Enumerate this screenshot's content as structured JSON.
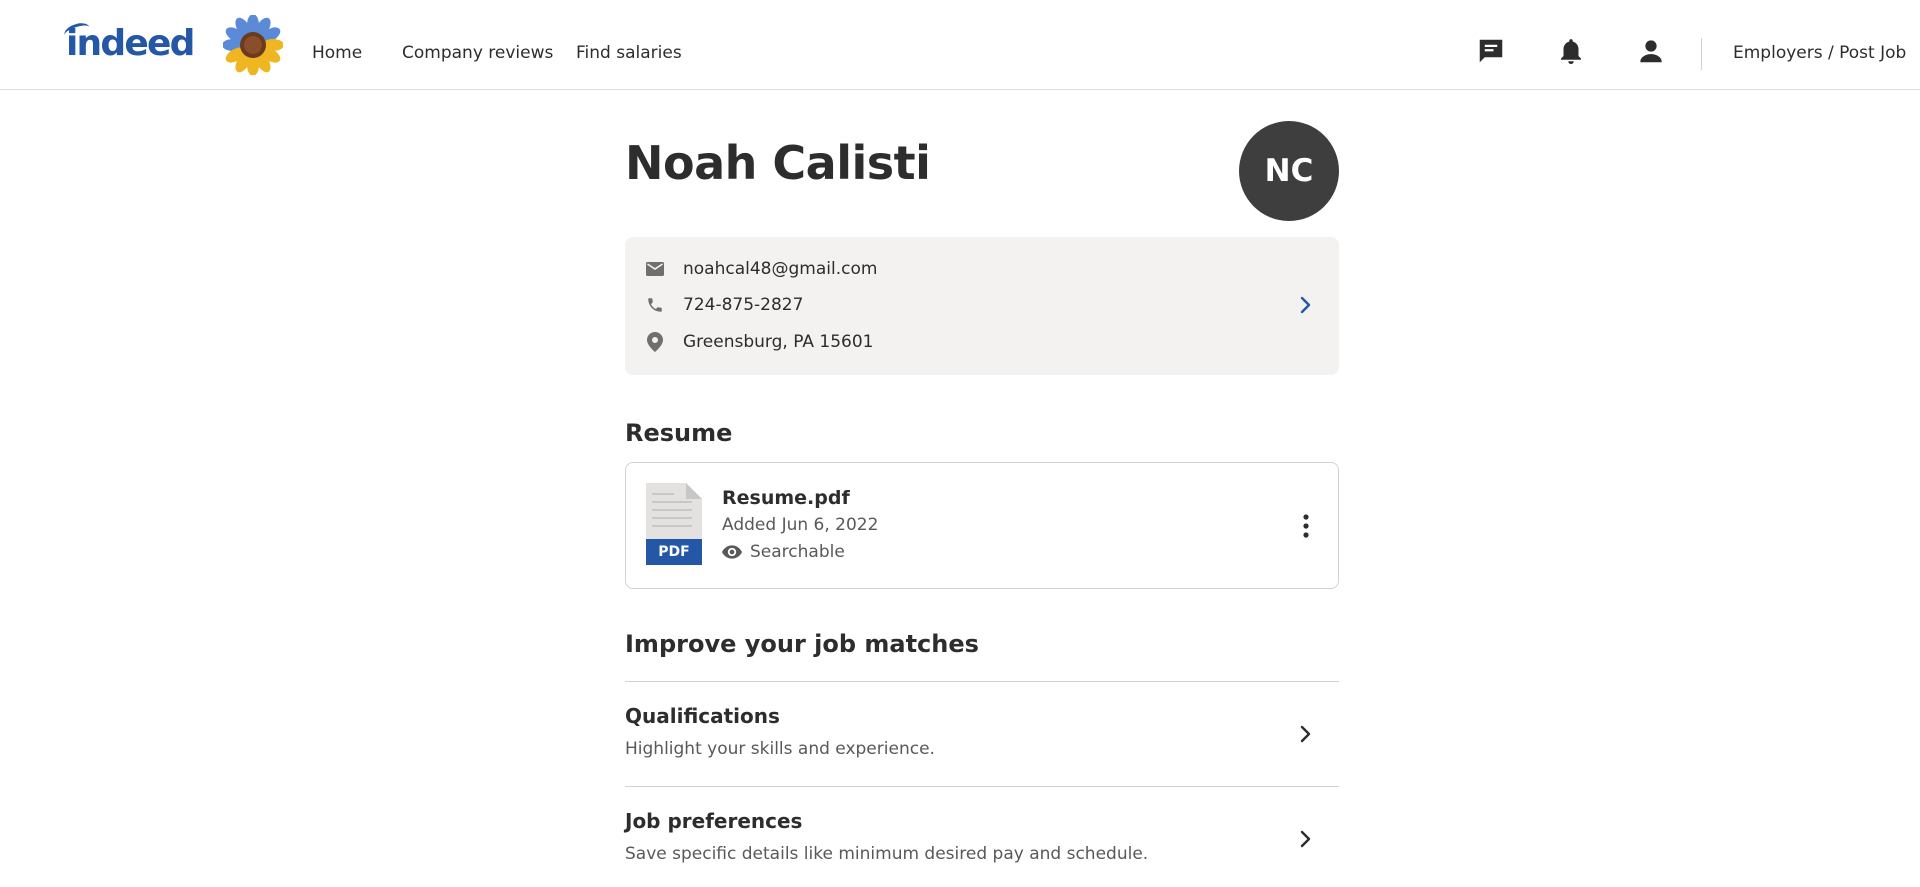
{
  "header": {
    "logo_text": "indeed",
    "nav": {
      "home": "Home",
      "company_reviews": "Company reviews",
      "find_salaries": "Find salaries",
      "employers": "Employers / Post Job"
    },
    "icons": [
      "messages-icon",
      "notifications-bell-icon",
      "account-icon"
    ]
  },
  "profile": {
    "name": "Noah Calisti",
    "initials": "NC",
    "email": "noahcal48@gmail.com",
    "phone": "724-875-2827",
    "location": "Greensburg, PA 15601"
  },
  "resume": {
    "section_title": "Resume",
    "file_name": "Resume.pdf",
    "file_type": "PDF",
    "added": "Added Jun 6, 2022",
    "visibility": "Searchable"
  },
  "improve": {
    "section_title": "Improve your job matches",
    "items": [
      {
        "title": "Qualifications",
        "subtitle": "Highlight your skills and experience."
      },
      {
        "title": "Job preferences",
        "subtitle": "Save specific details like minimum desired pay and schedule."
      }
    ]
  },
  "colors": {
    "brand_blue": "#2557a7",
    "avatar_bg": "#3e3e3e",
    "card_bg": "#f3f2f1",
    "text": "#2d2d2d",
    "muted": "#595959"
  }
}
